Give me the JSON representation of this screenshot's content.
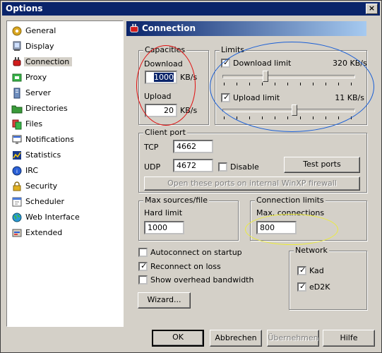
{
  "window": {
    "title": "Options",
    "close": "×"
  },
  "sidebar": {
    "items": [
      {
        "label": "General",
        "icon": "gear-icon"
      },
      {
        "label": "Display",
        "icon": "monitor-icon"
      },
      {
        "label": "Connection",
        "icon": "plug-icon"
      },
      {
        "label": "Proxy",
        "icon": "proxy-icon"
      },
      {
        "label": "Server",
        "icon": "server-icon"
      },
      {
        "label": "Directories",
        "icon": "folder-icon"
      },
      {
        "label": "Files",
        "icon": "files-icon"
      },
      {
        "label": "Notifications",
        "icon": "notification-icon"
      },
      {
        "label": "Statistics",
        "icon": "statistics-icon"
      },
      {
        "label": "IRC",
        "icon": "irc-icon"
      },
      {
        "label": "Security",
        "icon": "lock-icon"
      },
      {
        "label": "Scheduler",
        "icon": "calendar-icon"
      },
      {
        "label": "Web Interface",
        "icon": "globe-icon"
      },
      {
        "label": "Extended",
        "icon": "extended-icon"
      }
    ],
    "selected": "Connection"
  },
  "panel": {
    "title": "Connection",
    "capacities": {
      "title": "Capacities",
      "download_label": "Download",
      "download_value": "1000",
      "download_unit": "KB/s",
      "upload_label": "Upload",
      "upload_value": "20",
      "upload_unit": "KB/s"
    },
    "limits": {
      "title": "Limits",
      "download_limit_label": "Download limit",
      "download_limit_value": "320 KB/s",
      "download_slider_fraction": 0.32,
      "upload_limit_label": "Upload limit",
      "upload_limit_value": "11 KB/s",
      "upload_slider_fraction": 0.55
    },
    "client_port": {
      "title": "Client port",
      "tcp_label": "TCP",
      "tcp_value": "4662",
      "udp_label": "UDP",
      "udp_value": "4672",
      "disable_label": "Disable",
      "test_ports": "Test ports",
      "open_ports": "Open these ports on internal WinXP firewall"
    },
    "max_sources": {
      "title": "Max sources/file",
      "hard_limit_label": "Hard limit",
      "hard_limit_value": "1000"
    },
    "connection_limits": {
      "title": "Connection limits",
      "max_connections_label": "Max. connections",
      "max_connections_value": "800"
    },
    "options": {
      "autoconnect": "Autoconnect on startup",
      "reconnect": "Reconnect on loss",
      "overhead": "Show overhead bandwidth"
    },
    "network": {
      "title": "Network",
      "kad": "Kad",
      "ed2k": "eD2K"
    },
    "wizard": "Wizard..."
  },
  "footer": {
    "ok": "OK",
    "cancel": "Abbrechen",
    "apply": "Übernehmen",
    "help": "Hilfe"
  },
  "annotation_colors": {
    "red": "#e01010",
    "blue": "#1a5fd6",
    "yellow": "#ecec3a"
  }
}
